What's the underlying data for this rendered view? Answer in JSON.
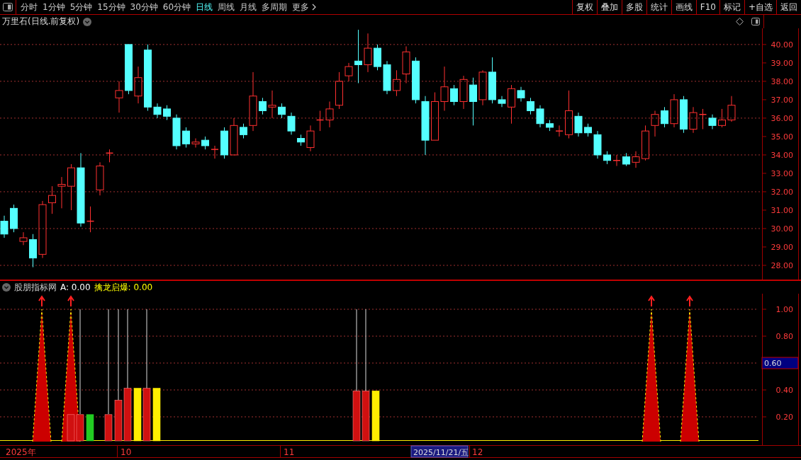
{
  "toolbar": {
    "periods": [
      {
        "label": "分时",
        "selected": false
      },
      {
        "label": "1分钟",
        "selected": false
      },
      {
        "label": "5分钟",
        "selected": false
      },
      {
        "label": "15分钟",
        "selected": false
      },
      {
        "label": "30分钟",
        "selected": false
      },
      {
        "label": "60分钟",
        "selected": false
      },
      {
        "label": "日线",
        "selected": true
      },
      {
        "label": "周线",
        "selected": false
      },
      {
        "label": "月线",
        "selected": false
      },
      {
        "label": "多周期",
        "selected": false
      },
      {
        "label": "更多",
        "selected": false
      }
    ],
    "actions": [
      "复权",
      "叠加",
      "多股",
      "统计",
      "画线",
      "F10",
      "标记",
      "+自选",
      "返回"
    ]
  },
  "main_chart": {
    "title": "万里石(日线.前复权)",
    "chart_data": {
      "type": "candlestick",
      "grid": true,
      "ylim": [
        27.23,
        40.88
      ],
      "yticks": [
        {
          "value": 40,
          "label": "40.00"
        },
        {
          "value": 39,
          "label": "39.00"
        },
        {
          "value": 38,
          "label": "38.00"
        },
        {
          "value": 37,
          "label": "37.00"
        },
        {
          "value": 36,
          "label": "36.00"
        },
        {
          "value": 35,
          "label": "35.00"
        },
        {
          "value": 34,
          "label": "34.00"
        },
        {
          "value": 33,
          "label": "33.00"
        },
        {
          "value": 32,
          "label": "32.00"
        },
        {
          "value": 31,
          "label": "31.00"
        },
        {
          "value": 30,
          "label": "30.00"
        },
        {
          "value": 29,
          "label": "29.00"
        },
        {
          "value": 28,
          "label": "28.00"
        }
      ],
      "ohlc": [
        [
          30.4,
          30.7,
          29.5,
          29.7
        ],
        [
          31.1,
          31.3,
          29.8,
          30.0
        ],
        [
          29.3,
          29.8,
          29.1,
          29.5
        ],
        [
          29.4,
          29.7,
          27.9,
          28.4
        ],
        [
          28.6,
          31.5,
          28.4,
          31.3
        ],
        [
          31.4,
          32.3,
          30.8,
          31.8
        ],
        [
          32.3,
          32.8,
          31.1,
          32.4
        ],
        [
          32.3,
          33.5,
          31.0,
          33.3
        ],
        [
          33.3,
          34.1,
          30.1,
          30.3
        ],
        [
          30.4,
          31.2,
          29.8,
          30.4
        ],
        [
          32.1,
          33.6,
          31.8,
          33.4
        ],
        [
          34.1,
          34.3,
          33.6,
          34.1
        ],
        [
          37.1,
          38.0,
          36.3,
          37.5
        ],
        [
          40.0,
          40.0,
          37.3,
          37.5
        ],
        [
          37.2,
          38.8,
          36.8,
          38.2
        ],
        [
          39.7,
          40.0,
          36.4,
          36.6
        ],
        [
          36.6,
          36.8,
          36.0,
          36.2
        ],
        [
          36.5,
          36.7,
          35.9,
          36.1
        ],
        [
          36.0,
          36.2,
          34.3,
          34.5
        ],
        [
          35.3,
          35.5,
          34.4,
          34.6
        ],
        [
          34.6,
          34.9,
          34.4,
          34.7
        ],
        [
          34.8,
          35.0,
          34.3,
          34.5
        ],
        [
          34.3,
          34.5,
          33.8,
          34.3
        ],
        [
          35.3,
          35.5,
          33.8,
          34.0
        ],
        [
          34.0,
          36.0,
          34.0,
          35.6
        ],
        [
          35.5,
          35.7,
          34.9,
          35.1
        ],
        [
          35.6,
          38.5,
          35.3,
          37.2
        ],
        [
          36.9,
          37.1,
          36.2,
          36.4
        ],
        [
          36.6,
          37.5,
          36.0,
          36.7
        ],
        [
          36.6,
          36.8,
          36.0,
          36.2
        ],
        [
          36.1,
          36.3,
          35.1,
          35.3
        ],
        [
          34.9,
          35.1,
          34.5,
          34.7
        ],
        [
          34.4,
          35.6,
          34.2,
          35.3
        ],
        [
          35.9,
          36.4,
          35.3,
          35.9
        ],
        [
          35.9,
          36.9,
          35.5,
          36.5
        ],
        [
          36.7,
          38.5,
          36.5,
          38.0
        ],
        [
          38.3,
          39.0,
          38.0,
          38.8
        ],
        [
          39.1,
          40.8,
          37.9,
          38.9
        ],
        [
          38.9,
          40.6,
          38.5,
          39.8
        ],
        [
          39.8,
          40.0,
          38.6,
          38.8
        ],
        [
          38.9,
          39.1,
          37.3,
          37.5
        ],
        [
          37.5,
          38.6,
          37.2,
          38.1
        ],
        [
          38.4,
          39.9,
          37.9,
          39.6
        ],
        [
          39.1,
          39.3,
          36.8,
          37.0
        ],
        [
          36.9,
          37.2,
          34.0,
          34.8
        ],
        [
          34.8,
          37.4,
          34.8,
          36.9
        ],
        [
          36.9,
          38.8,
          36.4,
          37.7
        ],
        [
          37.6,
          37.8,
          36.7,
          36.9
        ],
        [
          36.9,
          38.3,
          36.5,
          38.1
        ],
        [
          37.8,
          38.2,
          35.6,
          36.9
        ],
        [
          37.0,
          38.6,
          36.7,
          38.5
        ],
        [
          38.5,
          39.3,
          36.8,
          37.0
        ],
        [
          37.0,
          37.2,
          36.6,
          36.8
        ],
        [
          36.6,
          37.8,
          35.7,
          37.6
        ],
        [
          37.5,
          37.7,
          36.9,
          37.1
        ],
        [
          36.9,
          37.1,
          36.2,
          36.4
        ],
        [
          36.5,
          36.7,
          35.5,
          35.7
        ],
        [
          35.7,
          35.9,
          35.3,
          35.5
        ],
        [
          35.3,
          35.6,
          35.0,
          35.3
        ],
        [
          35.1,
          37.5,
          34.9,
          36.4
        ],
        [
          36.1,
          36.3,
          35.0,
          35.2
        ],
        [
          35.5,
          35.7,
          35.0,
          35.2
        ],
        [
          35.1,
          35.3,
          33.8,
          34.0
        ],
        [
          34.0,
          34.2,
          33.5,
          33.7
        ],
        [
          33.7,
          34.0,
          33.4,
          33.7
        ],
        [
          33.9,
          34.1,
          33.4,
          33.5
        ],
        [
          33.6,
          34.2,
          33.3,
          33.9
        ],
        [
          33.8,
          35.6,
          33.7,
          35.3
        ],
        [
          35.6,
          36.4,
          35.0,
          36.2
        ],
        [
          36.4,
          36.6,
          35.5,
          35.7
        ],
        [
          35.7,
          37.3,
          35.5,
          37.0
        ],
        [
          37.0,
          37.2,
          35.2,
          35.4
        ],
        [
          35.4,
          36.6,
          35.2,
          36.3
        ],
        [
          36.2,
          36.5,
          35.4,
          36.2
        ],
        [
          36.0,
          36.2,
          35.4,
          35.6
        ],
        [
          35.6,
          36.5,
          35.5,
          35.9
        ],
        [
          35.9,
          37.2,
          35.8,
          36.7
        ]
      ]
    }
  },
  "indicator": {
    "name": "股朋指标网",
    "legend": [
      {
        "text": "A: 0.00",
        "color": "#ffffff"
      },
      {
        "text": "擒龙启爆: 0.00",
        "color": "#ffff00"
      }
    ],
    "yticks": [
      "1.00",
      "0.80",
      "0.40",
      "0.20"
    ],
    "cursor_value": "0.60"
  },
  "date_axis": {
    "labels": [
      {
        "text": "2025年",
        "selected": false
      },
      {
        "text": "10",
        "selected": false
      },
      {
        "text": "11",
        "selected": false
      },
      {
        "text": "2025/11/21/五",
        "selected": true
      },
      {
        "text": "12",
        "selected": false
      }
    ]
  }
}
